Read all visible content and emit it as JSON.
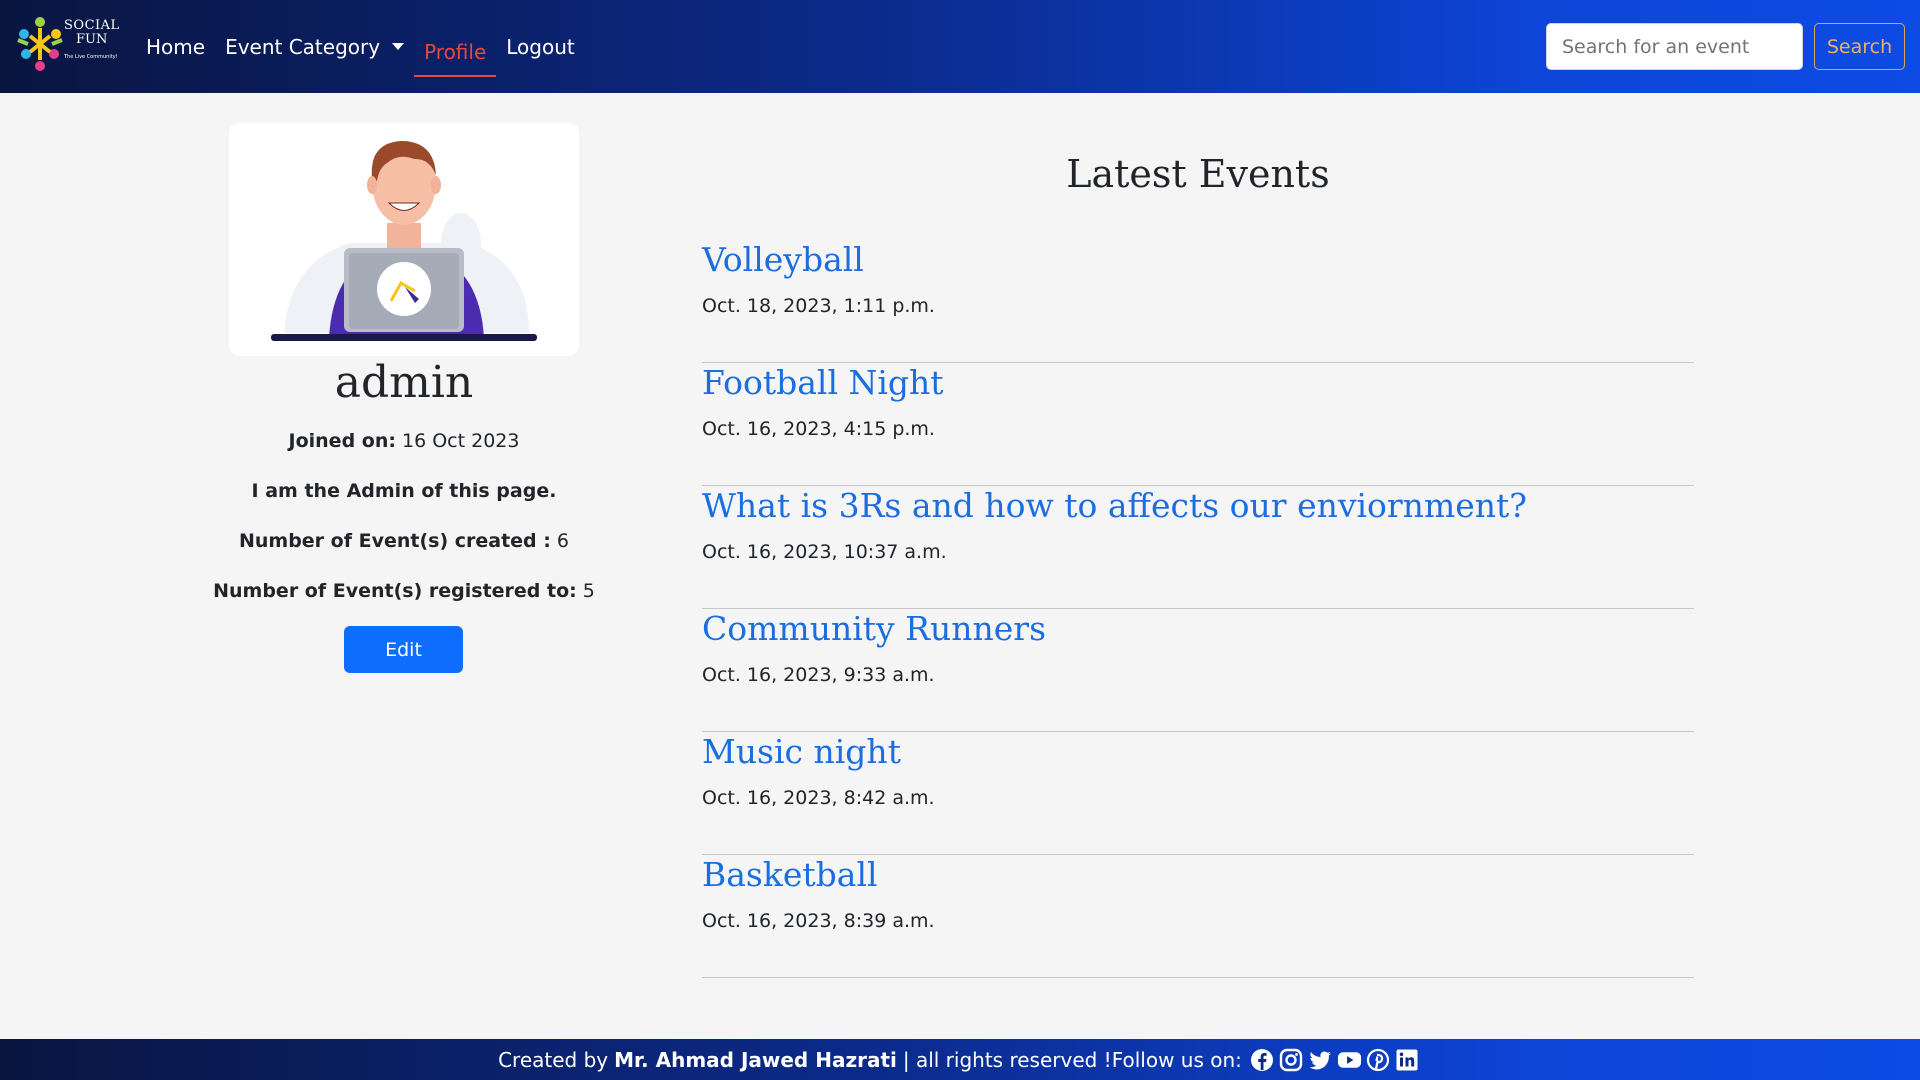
{
  "brand": {
    "line1": "SOCIAL",
    "line2": "FUN",
    "tagline": "The Live Community!"
  },
  "nav": {
    "home": "Home",
    "event_category": "Event Category",
    "profile": "Profile",
    "logout": "Logout"
  },
  "search": {
    "placeholder": "Search for an event",
    "button": "Search"
  },
  "profile": {
    "username": "admin",
    "joined_label": "Joined on:",
    "joined_value": "16 Oct 2023",
    "bio": "I am the Admin of this page.",
    "created_label": "Number of Event(s) created :",
    "created_value": "6",
    "registered_label": "Number of Event(s) registered to:",
    "registered_value": "5",
    "edit_button": "Edit"
  },
  "events": {
    "heading": "Latest Events",
    "items": [
      {
        "title": "Volleyball",
        "date": "Oct. 18, 2023, 1:11 p.m."
      },
      {
        "title": "Football Night",
        "date": "Oct. 16, 2023, 4:15 p.m."
      },
      {
        "title": "What is 3Rs and how to affects our enviornment?",
        "date": "Oct. 16, 2023, 10:37 a.m."
      },
      {
        "title": "Community Runners",
        "date": "Oct. 16, 2023, 9:33 a.m."
      },
      {
        "title": "Music night",
        "date": "Oct. 16, 2023, 8:42 a.m."
      },
      {
        "title": "Basketball",
        "date": "Oct. 16, 2023, 8:39 a.m."
      }
    ]
  },
  "footer": {
    "created_by": "Created by",
    "author": "Mr. Ahmad Jawed Hazrati",
    "rights": "| all rights reserved !Follow us on:",
    "social_icons": [
      "facebook-icon",
      "instagram-icon",
      "twitter-icon",
      "youtube-icon",
      "pinterest-icon",
      "linkedin-icon"
    ]
  },
  "colors": {
    "nav_gradient_start": "#0a1540",
    "nav_gradient_end": "#0d4be4",
    "active_link": "#e8493a",
    "event_link": "#1a6ee0",
    "edit_button": "#0d6efd",
    "search_button": "#f0b060",
    "page_bg": "#f5f5f5"
  }
}
